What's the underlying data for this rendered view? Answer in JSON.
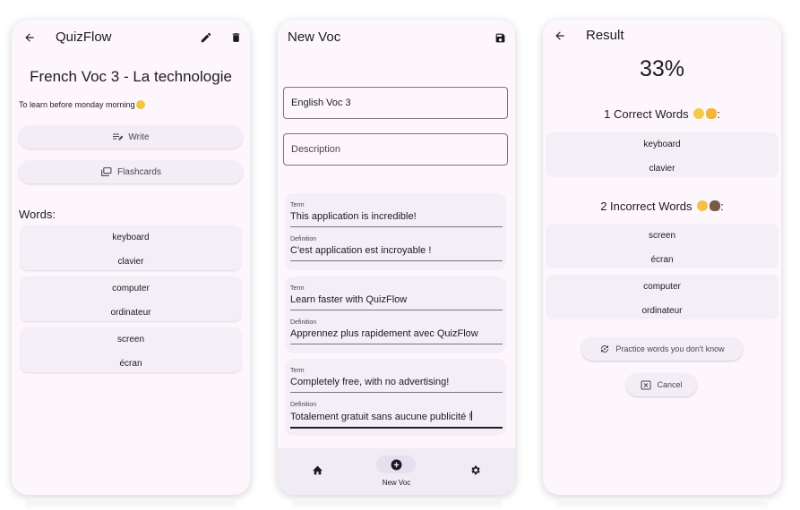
{
  "screen1": {
    "title": "QuizFlow",
    "deck_title": "French Voc 3 - La technologie",
    "description": "To learn before monday morning",
    "write_label": "Write",
    "flashcards_label": "Flashcards",
    "words_heading": "Words:",
    "words": [
      {
        "term": "keyboard",
        "definition": "clavier"
      },
      {
        "term": "computer",
        "definition": "ordinateur"
      },
      {
        "term": "screen",
        "definition": "écran"
      }
    ]
  },
  "screen2": {
    "title": "New Voc",
    "name_value": "English Voc 3",
    "description_placeholder": "Description",
    "term_label": "Term",
    "definition_label": "Definition",
    "cards": [
      {
        "term": "This application is incredible!",
        "definition": "C'est application est incroyable !"
      },
      {
        "term": "Learn faster with QuizFlow",
        "definition": "Apprennez plus rapidement avec QuizFlow"
      },
      {
        "term": "Completely free, with no advertising!",
        "definition": "Totalement gratuit sans aucune publicité !"
      }
    ],
    "nav_active_label": "New Voc"
  },
  "screen3": {
    "title": "Result",
    "score": "33%",
    "correct_heading": "1 Correct Words",
    "correct": [
      {
        "term": "keyboard",
        "definition": "clavier"
      }
    ],
    "incorrect_heading": "2 Incorrect Words",
    "incorrect": [
      {
        "term": "screen",
        "definition": "écran"
      },
      {
        "term": "computer",
        "definition": "ordinateur"
      }
    ],
    "practice_label": "Practice words you don't know",
    "cancel_label": "Cancel"
  },
  "colors": {
    "surface": "#fdf7fd",
    "card": "#f4eef6",
    "text": "#1c1b1f",
    "nav_indicator": "#e6dff0"
  },
  "icons": [
    "back-arrow-icon",
    "pencil-icon",
    "trash-icon",
    "write-icon",
    "flashcards-icon",
    "save-icon",
    "home-icon",
    "add-circle-icon",
    "gear-icon",
    "practice-icon",
    "close-box-icon"
  ]
}
